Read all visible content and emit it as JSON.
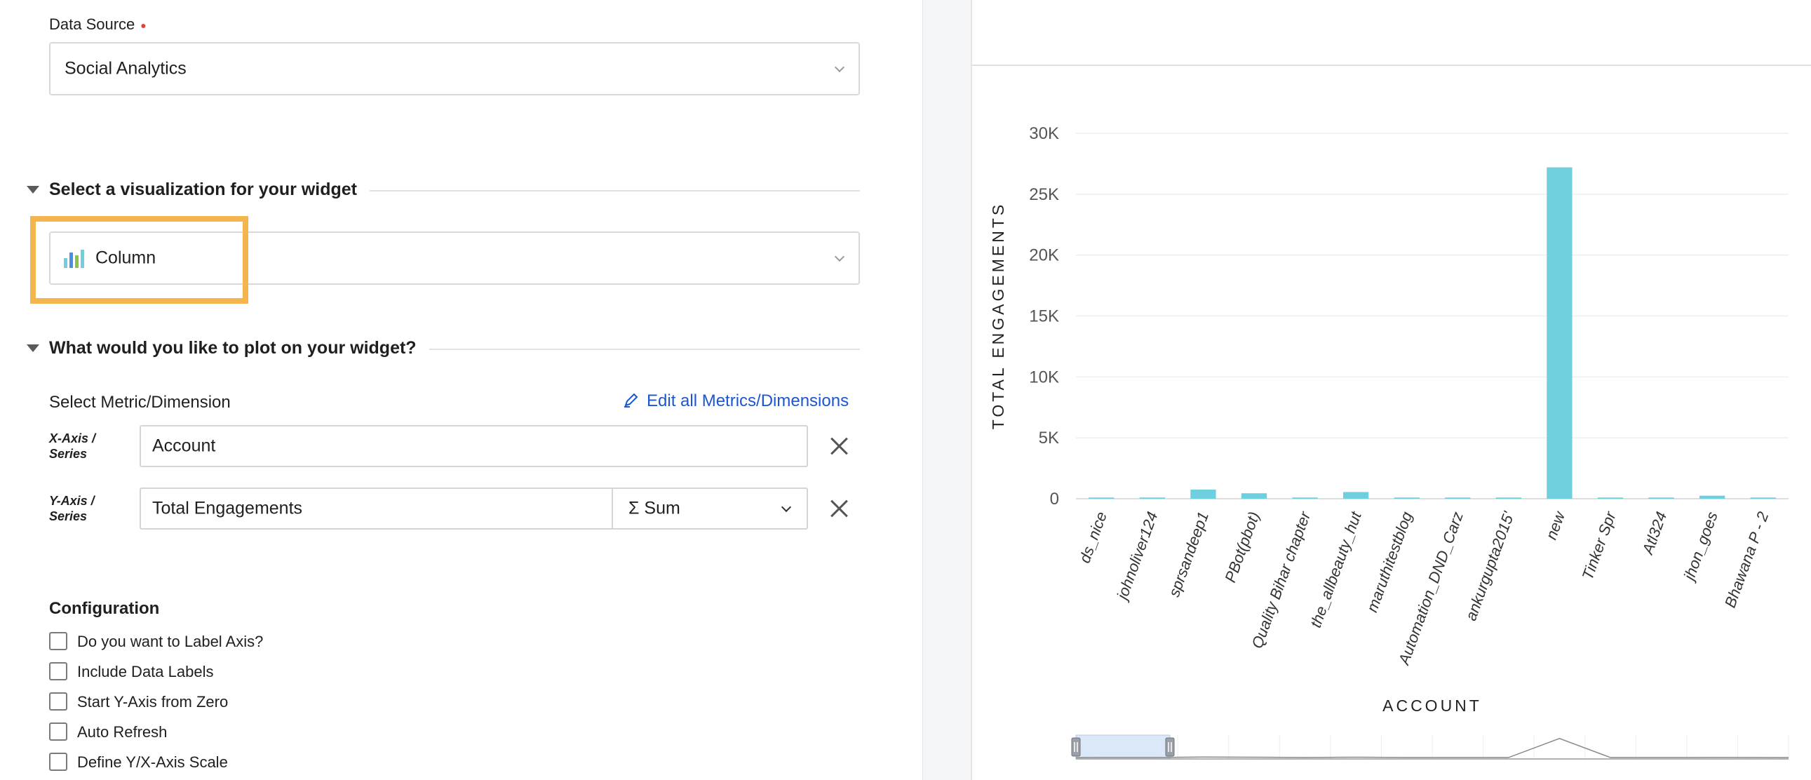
{
  "data_source": {
    "label": "Data Source",
    "required_mark": "●",
    "value": "Social Analytics"
  },
  "visualization": {
    "section_title": "Select a visualization for your widget",
    "value": "Column",
    "icon": "column-chart-icon"
  },
  "plot": {
    "section_title": "What would you like to plot on your widget?",
    "select_label": "Select Metric/Dimension",
    "edit_link": "Edit all Metrics/Dimensions",
    "x_axis": {
      "label_line1": "X-Axis /",
      "label_line2": "Series",
      "value": "Account"
    },
    "y_axis": {
      "label_line1": "Y-Axis /",
      "label_line2": "Series",
      "value": "Total Engagements",
      "aggregation_symbol": "Σ",
      "aggregation": "Sum"
    }
  },
  "configuration": {
    "title": "Configuration",
    "options": [
      {
        "label": "Do you want to Label Axis?",
        "checked": false
      },
      {
        "label": "Include Data Labels",
        "checked": false
      },
      {
        "label": "Start Y-Axis from Zero",
        "checked": false
      },
      {
        "label": "Auto Refresh",
        "checked": false
      },
      {
        "label": "Define Y/X-Axis Scale",
        "checked": false
      }
    ]
  },
  "colors": {
    "bar": "#6ecfdf",
    "highlight": "#f5b54e",
    "link": "#1b56d4",
    "required": "#e0403a"
  },
  "chart_data": {
    "type": "bar",
    "xlabel": "ACCOUNT",
    "ylabel": "TOTAL ENGAGEMENTS",
    "ylim": [
      0,
      30000
    ],
    "yticks": [
      0,
      5000,
      10000,
      15000,
      20000,
      25000,
      30000
    ],
    "ytick_labels": [
      "0",
      "5K",
      "10K",
      "15K",
      "20K",
      "25K",
      "30K"
    ],
    "grid": true,
    "categories": [
      "ds_nice",
      "johnoliver124",
      "sprsandeep1",
      "PBot(pbot)",
      "Quality Bihar chapter",
      "the_allbeauty_hut",
      "maruthitestblog",
      "Automation_DND_Carz",
      "ankurgupta2015'",
      "new",
      "Tinker Spr",
      "Atl324",
      "jhon_goes",
      "Bhawana P - 2"
    ],
    "values": [
      100,
      100,
      750,
      450,
      100,
      550,
      100,
      100,
      100,
      27200,
      100,
      100,
      250,
      100
    ]
  }
}
